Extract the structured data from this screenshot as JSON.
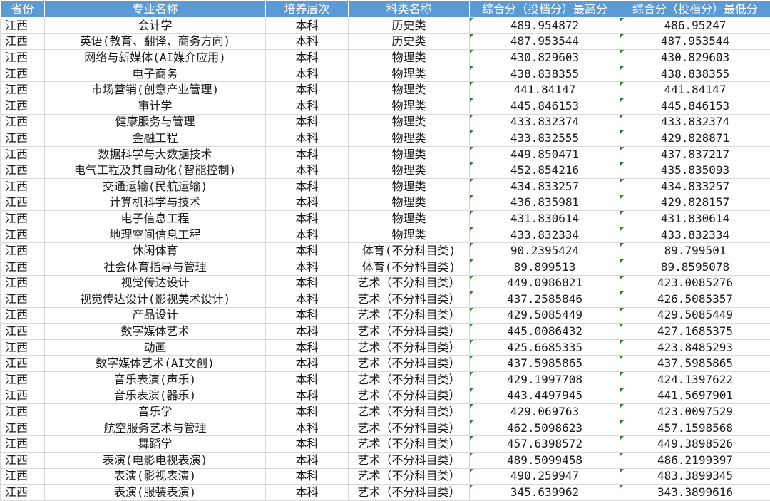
{
  "columns": [
    "省份",
    "专业名称",
    "培养层次",
    "科类名称",
    "综合分（投档分）最高分",
    "综合分（投档分）最低分"
  ],
  "rows": [
    [
      "江西",
      "会计学",
      "本科",
      "历史类",
      "489.954872",
      "486.95247"
    ],
    [
      "江西",
      "英语(教育、翻译、商务方向)",
      "本科",
      "历史类",
      "487.953544",
      "487.953544"
    ],
    [
      "江西",
      "网络与新媒体(AI媒介应用)",
      "本科",
      "物理类",
      "430.829603",
      "430.829603"
    ],
    [
      "江西",
      "电子商务",
      "本科",
      "物理类",
      "438.838355",
      "438.838355"
    ],
    [
      "江西",
      "市场营销(创意产业管理)",
      "本科",
      "物理类",
      "441.84147",
      "441.84147"
    ],
    [
      "江西",
      "审计学",
      "本科",
      "物理类",
      "445.846153",
      "445.846153"
    ],
    [
      "江西",
      "健康服务与管理",
      "本科",
      "物理类",
      "433.832374",
      "433.832374"
    ],
    [
      "江西",
      "金融工程",
      "本科",
      "物理类",
      "433.832555",
      "429.828871"
    ],
    [
      "江西",
      "数据科学与大数据技术",
      "本科",
      "物理类",
      "449.850471",
      "437.837217"
    ],
    [
      "江西",
      "电气工程及其自动化(智能控制)",
      "本科",
      "物理类",
      "452.854216",
      "435.835093"
    ],
    [
      "江西",
      "交通运输(民航运输)",
      "本科",
      "物理类",
      "434.833257",
      "434.833257"
    ],
    [
      "江西",
      "计算机科学与技术",
      "本科",
      "物理类",
      "436.835981",
      "429.828157"
    ],
    [
      "江西",
      "电子信息工程",
      "本科",
      "物理类",
      "431.830614",
      "431.830614"
    ],
    [
      "江西",
      "地理空间信息工程",
      "本科",
      "物理类",
      "433.832334",
      "433.832334"
    ],
    [
      "江西",
      "休闲体育",
      "本科",
      "体育(不分科目类)",
      "90.2395424",
      "89.799501"
    ],
    [
      "江西",
      "社会体育指导与管理",
      "本科",
      "体育(不分科目类)",
      "89.899513",
      "89.8595078"
    ],
    [
      "江西",
      "视觉传达设计",
      "本科",
      "艺术（不分科目类）",
      "449.0986821",
      "423.0085276"
    ],
    [
      "江西",
      "视觉传达设计(影视美术设计)",
      "本科",
      "艺术（不分科目类）",
      "437.2585846",
      "426.5085357"
    ],
    [
      "江西",
      "产品设计",
      "本科",
      "艺术（不分科目类）",
      "429.5085449",
      "429.5085449"
    ],
    [
      "江西",
      "数字媒体艺术",
      "本科",
      "艺术（不分科目类）",
      "445.0086432",
      "427.1685375"
    ],
    [
      "江西",
      "动画",
      "本科",
      "艺术（不分科目类）",
      "425.6685335",
      "423.8485293"
    ],
    [
      "江西",
      "数字媒体艺术(AI文创)",
      "本科",
      "艺术（不分科目类）",
      "437.5985865",
      "437.5985865"
    ],
    [
      "江西",
      "音乐表演(声乐)",
      "本科",
      "艺术（不分科目类）",
      "429.1997708",
      "424.1397622"
    ],
    [
      "江西",
      "音乐表演(器乐)",
      "本科",
      "艺术（不分科目类）",
      "443.4497945",
      "441.5697901"
    ],
    [
      "江西",
      "音乐学",
      "本科",
      "艺术（不分科目类）",
      "429.069763",
      "423.0097529"
    ],
    [
      "江西",
      "航空服务艺术与管理",
      "本科",
      "艺术（不分科目类）",
      "462.5098623",
      "457.1598568"
    ],
    [
      "江西",
      "舞蹈学",
      "本科",
      "艺术（不分科目类）",
      "457.6398572",
      "449.3898526"
    ],
    [
      "江西",
      "表演(电影电视表演)",
      "本科",
      "艺术（不分科目类）",
      "489.5099458",
      "486.2199397"
    ],
    [
      "江西",
      "表演(影视表演)",
      "本科",
      "艺术（不分科目类）",
      "490.259947",
      "483.3899345"
    ],
    [
      "江西",
      "表演(服装表演)",
      "本科",
      "艺术（不分科目类）",
      "345.639962",
      "343.3899616"
    ]
  ]
}
